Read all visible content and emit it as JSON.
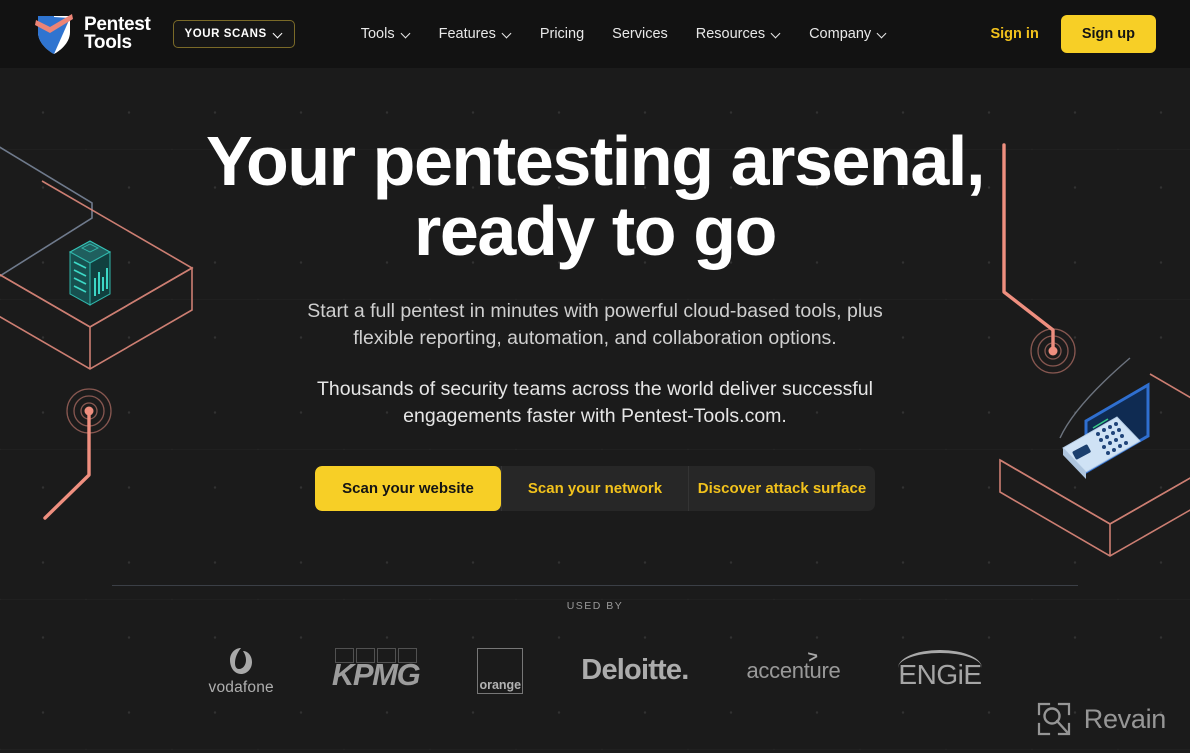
{
  "brand": {
    "logo_line1": "Pentest",
    "logo_line2": "Tools",
    "logo_icon": "shield-check-logo"
  },
  "header": {
    "your_scans_label": "YOUR SCANS",
    "your_scans_icon": "chevron-down-icon",
    "nav": [
      {
        "label": "Tools",
        "has_dropdown": true
      },
      {
        "label": "Features",
        "has_dropdown": true
      },
      {
        "label": "Pricing",
        "has_dropdown": false
      },
      {
        "label": "Services",
        "has_dropdown": false
      },
      {
        "label": "Resources",
        "has_dropdown": true
      },
      {
        "label": "Company",
        "has_dropdown": true
      }
    ],
    "sign_in_label": "Sign in",
    "sign_up_label": "Sign up"
  },
  "hero": {
    "heading_line1": "Your pentesting arsenal,",
    "heading_line2": "ready to go",
    "subtitle": "Start a full pentest in minutes with powerful cloud-based tools, plus flexible reporting, automation, and collaboration options.",
    "subtitle2": "Thousands of security teams across the world deliver successful engagements faster with Pentest-Tools.com."
  },
  "cta": {
    "buttons": [
      {
        "label": "Scan your website",
        "active": true
      },
      {
        "label": "Scan your network",
        "active": false
      },
      {
        "label": "Discover attack surface",
        "active": false
      }
    ]
  },
  "used_by": {
    "label": "USED BY",
    "logos": [
      {
        "name": "vodafone",
        "text": "vodafone"
      },
      {
        "name": "kpmg",
        "text": "KPMG"
      },
      {
        "name": "orange",
        "text": "orange"
      },
      {
        "name": "deloitte",
        "text": "Deloitte."
      },
      {
        "name": "accenture",
        "text": "accenture",
        "mark": ">"
      },
      {
        "name": "engie",
        "text": "ENGiE"
      }
    ]
  },
  "watermark": {
    "text": "Revain",
    "icon": "magnifier-square-icon"
  },
  "colors": {
    "background": "#1b1b1b",
    "header_background": "#121212",
    "accent_yellow": "#f7cf26",
    "accent_yellow_text": "#f2c21c",
    "salmon": "#e8867a",
    "teal": "#2fd3c4",
    "blue": "#2f6fd0",
    "text_primary": "#ffffff",
    "text_secondary": "#cfcfcf",
    "divider": "#3b3f46"
  },
  "decor": {
    "left_platform": "isometric-platform-outline",
    "left_object": "server-rack-isometric",
    "left_ping": "radar-ping-marker",
    "right_ping": "radar-ping-marker",
    "right_object": "laptop-isometric",
    "right_platform": "isometric-platform-outline"
  }
}
